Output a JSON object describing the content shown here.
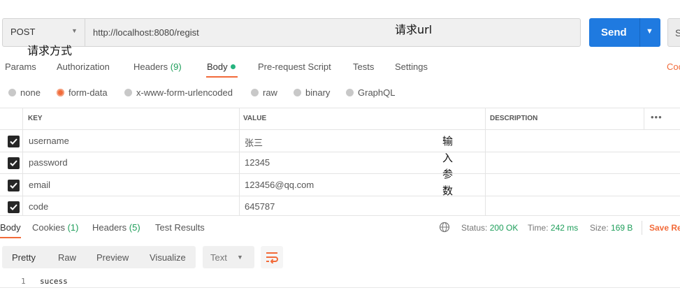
{
  "request": {
    "method": "POST",
    "url": "http://localhost:8080/regist",
    "send_label": "Send",
    "save_label": "S"
  },
  "annotations": {
    "url_note": "请求url",
    "method_note": "请求方式",
    "params_note": "输入参数"
  },
  "request_tabs": [
    {
      "label": "Params",
      "count": ""
    },
    {
      "label": "Authorization",
      "count": ""
    },
    {
      "label": "Headers",
      "count": "(9)"
    },
    {
      "label": "Body",
      "count": ""
    },
    {
      "label": "Pre-request Script",
      "count": ""
    },
    {
      "label": "Tests",
      "count": ""
    },
    {
      "label": "Settings",
      "count": ""
    }
  ],
  "cookies_link": "Coo",
  "body_types": [
    "none",
    "form-data",
    "x-www-form-urlencoded",
    "raw",
    "binary",
    "GraphQL"
  ],
  "body_type_selected": "form-data",
  "table": {
    "headers": {
      "key": "KEY",
      "value": "VALUE",
      "description": "DESCRIPTION"
    },
    "rows": [
      {
        "key": "username",
        "value": "张三",
        "checked": true
      },
      {
        "key": "password",
        "value": "12345",
        "checked": true
      },
      {
        "key": "email",
        "value": "123456@qq.com",
        "checked": true
      },
      {
        "key": "code",
        "value": "645787",
        "checked": true
      }
    ],
    "more_label": "•••"
  },
  "response_tabs": [
    {
      "label": "Body",
      "count": ""
    },
    {
      "label": "Cookies",
      "count": "(1)"
    },
    {
      "label": "Headers",
      "count": "(5)"
    },
    {
      "label": "Test Results",
      "count": ""
    }
  ],
  "status": {
    "status_label": "Status:",
    "status_value": "200 OK",
    "time_label": "Time:",
    "time_value": "242 ms",
    "size_label": "Size:",
    "size_value": "169 B",
    "save_response": "Save Re"
  },
  "view_modes": [
    "Pretty",
    "Raw",
    "Preview",
    "Visualize"
  ],
  "format_selected": "Text",
  "response_body": {
    "line_number": "1",
    "text": "sucess"
  },
  "colors": {
    "accent": "#f26b3a",
    "send": "#1f7ae0",
    "success": "#1e9e5a"
  }
}
